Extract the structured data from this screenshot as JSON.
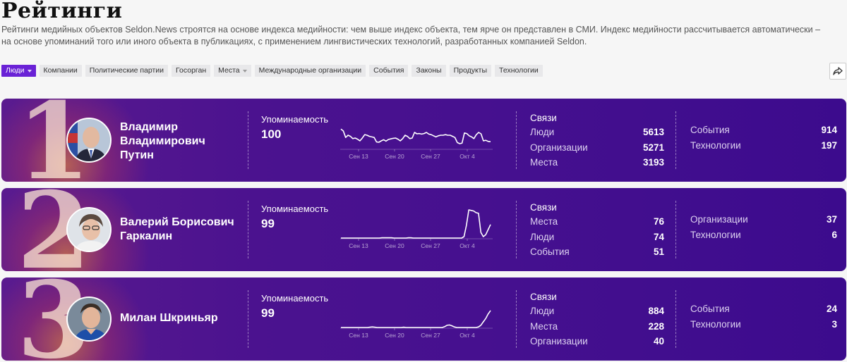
{
  "page": {
    "title": "Рейтинги",
    "description": "Рейтинги медийных объектов Seldon.News строятся на основе индекса медийности: чем выше индекс объекта, тем ярче он представлен в СМИ. Индекс медийности рассчитывается автоматически – на основе упоминаний того или иного объекта в публикациях, с применением лингвистических технологий, разработанных компанией Seldon."
  },
  "filters": [
    {
      "label": "Люди",
      "active": true,
      "dropdown": true
    },
    {
      "label": "Компании",
      "active": false,
      "dropdown": false
    },
    {
      "label": "Политические партии",
      "active": false,
      "dropdown": false
    },
    {
      "label": "Госорган",
      "active": false,
      "dropdown": false
    },
    {
      "label": "Места",
      "active": false,
      "dropdown": true
    },
    {
      "label": "Международные организации",
      "active": false,
      "dropdown": false
    },
    {
      "label": "События",
      "active": false,
      "dropdown": false
    },
    {
      "label": "Законы",
      "active": false,
      "dropdown": false
    },
    {
      "label": "Продукты",
      "active": false,
      "dropdown": false
    },
    {
      "label": "Технологии",
      "active": false,
      "dropdown": false
    }
  ],
  "share_icon": "share-arrow-icon",
  "colors": {
    "accent": "#6a22d6",
    "card_bg": "#45108f"
  },
  "labels": {
    "mentions": "Упоминаемость",
    "links": "Связи"
  },
  "axis_dates": [
    "Сен 13",
    "Сен 20",
    "Сен 27",
    "Окт 4"
  ],
  "cards": [
    {
      "rank": "1",
      "name_lines": [
        "Владимир",
        "Владимирович",
        "Путин"
      ],
      "mentions_value": "100",
      "sparkline": [
        0.72,
        0.65,
        0.42,
        0.5,
        0.46,
        0.38,
        0.4,
        0.36,
        0.3,
        0.4,
        0.52,
        0.5,
        0.46,
        0.44,
        0.42,
        0.26,
        0.25,
        0.3,
        0.34,
        0.29,
        0.35,
        0.37,
        0.39,
        0.4,
        0.36,
        0.3,
        0.38,
        0.5,
        0.46,
        0.38,
        0.4,
        0.6,
        0.55,
        0.56,
        0.54,
        0.56,
        0.6,
        0.54,
        0.52,
        0.48,
        0.44,
        0.48,
        0.5,
        0.5,
        0.52,
        0.5,
        0.5,
        0.46,
        0.42,
        0.24,
        0.2,
        0.22,
        0.58,
        0.56,
        0.48,
        0.44,
        0.38,
        0.52,
        0.6,
        0.55,
        0.3,
        0.32,
        0.28,
        0.27
      ],
      "links": [
        {
          "label": "Люди",
          "value": "5613"
        },
        {
          "label": "Организации",
          "value": "5271"
        },
        {
          "label": "Места",
          "value": "3193"
        }
      ],
      "extra": [
        {
          "label": "События",
          "value": "914"
        },
        {
          "label": "Технологии",
          "value": "197"
        }
      ]
    },
    {
      "rank": "2",
      "name_lines": [
        "Валерий Борисович",
        "Гаркалин"
      ],
      "mentions_value": "99",
      "sparkline": [
        0,
        0,
        0,
        0,
        0,
        0,
        0,
        0,
        0,
        0,
        0,
        0,
        0,
        0,
        0,
        0,
        0,
        0.01,
        0.01,
        0.01,
        0.01,
        0.01,
        0,
        0,
        0,
        0,
        0,
        0,
        0.01,
        0.01,
        0,
        0,
        0,
        0,
        0,
        0,
        0,
        0,
        0,
        0,
        0,
        0,
        0,
        0,
        0,
        0,
        0,
        0,
        0,
        0,
        0,
        0.05,
        0.45,
        1,
        0.98,
        0.96,
        0.9,
        0.88,
        0.2,
        0.05,
        0.12,
        0.3,
        0.48
      ],
      "links": [
        {
          "label": "Места",
          "value": "76"
        },
        {
          "label": "Люди",
          "value": "74"
        },
        {
          "label": "События",
          "value": "51"
        }
      ],
      "extra": [
        {
          "label": "Организации",
          "value": "37"
        },
        {
          "label": "Технологии",
          "value": "6"
        }
      ]
    },
    {
      "rank": "3",
      "name_lines": [
        "Милан Шкриньяр"
      ],
      "mentions_value": "99",
      "sparkline": [
        0,
        0,
        0,
        0,
        0,
        0,
        0,
        0,
        0,
        0,
        0,
        0,
        0.01,
        0.02,
        0.01,
        0,
        0,
        0,
        0,
        0,
        0,
        0,
        0,
        0,
        0,
        0,
        0.01,
        0,
        0,
        0,
        0,
        0,
        0,
        0,
        0,
        0,
        0,
        0,
        0,
        0,
        0,
        0,
        0,
        0.03,
        0.08,
        0.09,
        0.06,
        0.02,
        0,
        0,
        0,
        0,
        0,
        0,
        0,
        0,
        0,
        0.02,
        0.08,
        0.2,
        0.32,
        0.48,
        0.6
      ],
      "links": [
        {
          "label": "Люди",
          "value": "884"
        },
        {
          "label": "Места",
          "value": "228"
        },
        {
          "label": "Организации",
          "value": "40"
        }
      ],
      "extra": [
        {
          "label": "События",
          "value": "24"
        },
        {
          "label": "Технологии",
          "value": "3"
        }
      ]
    }
  ]
}
